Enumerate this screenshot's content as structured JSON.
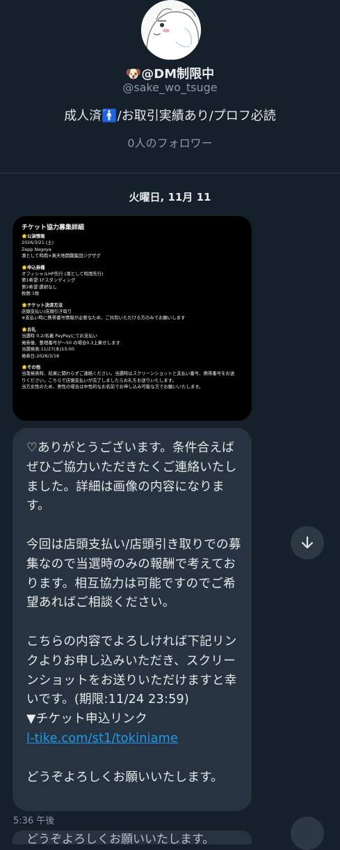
{
  "profile": {
    "name": "🐶@DM制限中",
    "handle": "@sake_wo_tsuge",
    "bio": "成人済🚹/お取引実績あり/プロフ必読",
    "followers": "0人のフォロワー"
  },
  "conversation": {
    "date_label": "火曜日, 11月 11",
    "time_label": "5:36 午後",
    "next_message_preview": "どうぞよろしくお願いいたします。"
  },
  "image_message": {
    "title": "チケット協力募集詳細",
    "lines": [
      "🌟公演情報",
      "2026/3/21 (土)",
      "Zepp Nagoya",
      "凛として時雨×真天地開闢集団ジグザグ",
      "",
      "🌟申込券種",
      "オフィシャルHP先行 (凛として時雨先行)",
      "第1希望:1Fスタンディング",
      "第2希望:選択なし",
      "枚数:1枚",
      "",
      "🌟チケット決済方法",
      "店頭支払い/店頭引き取り",
      "※支払い時に携帯番号情報が必要なため、ご共有いただける方のみでお願いします",
      "",
      "🌟お礼",
      "当選時 0.2/名義 PayPayにてお支払い",
      "発券後、整理番号が〜50 の場合0.3上乗せします",
      "当選発表:11/27(木)15:00",
      "発券日:2026/3/18",
      "",
      "🌟その他",
      "当落発表時、結果に関わらずご連絡ください。当選時はスクリーンショットと支払い番号、携帯番号をお送",
      "りください。こちらで店頭支払いが完了しましたらお礼をお送りいたします。",
      "当方女性のため、男性の場合は中性的なお名前でお申し込み可能な方でお願いいたします。"
    ]
  },
  "text_message": {
    "p1": "♡ありがとうございます。条件合えばぜひご協力いただきたくご連絡いたしました。詳細は画像の内容になります。",
    "p2": "今回は店頭支払い/店頭引き取りでの募集なので当選時のみの報酬で考えております。相互協力は可能ですのでご希望あればご相談ください。",
    "p3": "こちらの内容でよろしければ下記リンクよりお申し込みいただき、スクリーンショットをお送りいただけますと幸いです。(期限:11/24 23:59)",
    "link_label": "▼チケット申込リンク",
    "link_text": "l-tike.com/st1/tokiniame",
    "p4": "どうぞよろしくお願いいたします。"
  },
  "icons": {
    "scroll_down": "arrow-down-icon"
  },
  "colors": {
    "background": "#15202b",
    "bubble": "#273340",
    "link": "#1d9bf0",
    "muted": "#8b98a5"
  }
}
